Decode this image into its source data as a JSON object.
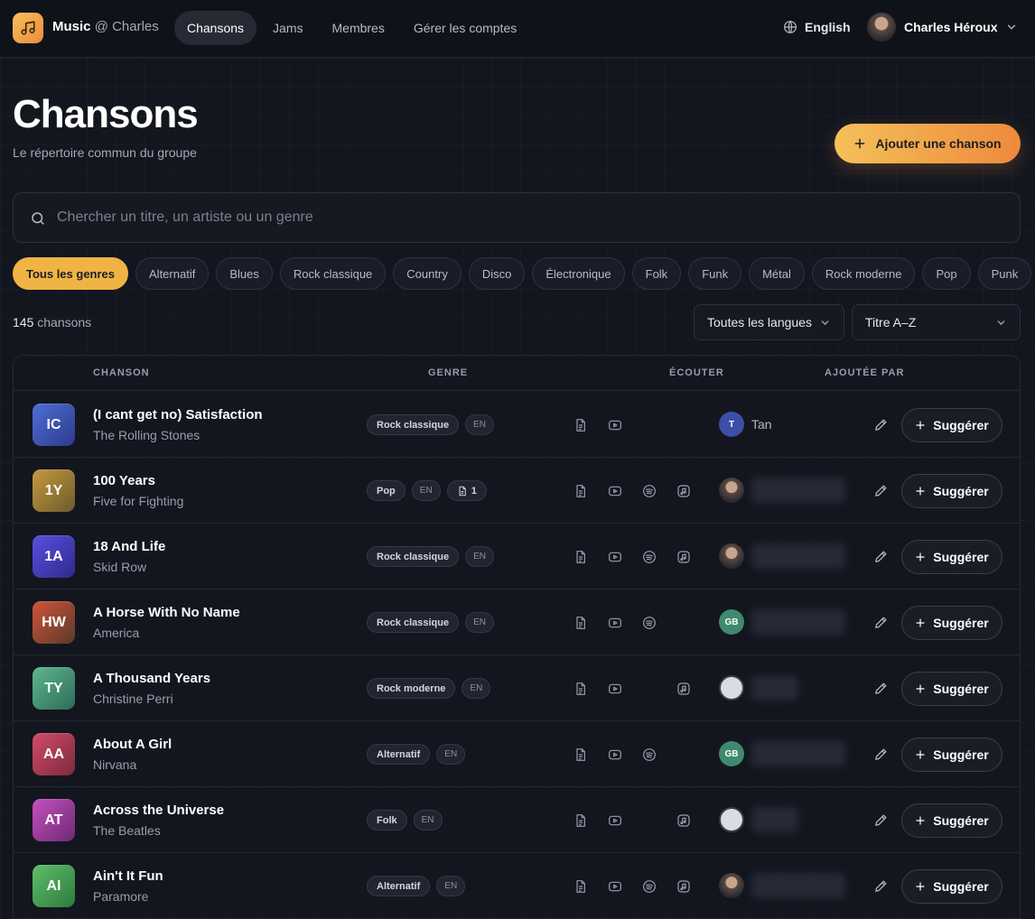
{
  "app": {
    "brand": "Music",
    "brand_suffix": "@ Charles"
  },
  "nav": [
    {
      "label": "Chansons",
      "active": true
    },
    {
      "label": "Jams",
      "active": false
    },
    {
      "label": "Membres",
      "active": false
    },
    {
      "label": "Gérer les comptes",
      "active": false
    }
  ],
  "language_switch": {
    "label": "English",
    "icon": "globe-icon"
  },
  "user": {
    "name": "Charles Héroux"
  },
  "page": {
    "title": "Chansons",
    "subtitle": "Le répertoire commun du groupe",
    "add_button": "Ajouter une chanson"
  },
  "search": {
    "placeholder": "Chercher un titre, un artiste ou un genre",
    "value": ""
  },
  "genres": [
    {
      "label": "Tous les genres",
      "active": true
    },
    {
      "label": "Alternatif"
    },
    {
      "label": "Blues"
    },
    {
      "label": "Rock classique"
    },
    {
      "label": "Country"
    },
    {
      "label": "Disco"
    },
    {
      "label": "Électronique"
    },
    {
      "label": "Folk"
    },
    {
      "label": "Funk"
    },
    {
      "label": "Métal"
    },
    {
      "label": "Rock moderne"
    },
    {
      "label": "Pop"
    },
    {
      "label": "Punk"
    }
  ],
  "count": {
    "number": "145",
    "label": "chansons"
  },
  "filters": {
    "language": "Toutes les langues",
    "sort": "Titre A–Z"
  },
  "table": {
    "headers": {
      "song": "CHANSON",
      "genre": "GENRE",
      "listen": "ÉCOUTER",
      "added_by": "AJOUTÉE PAR"
    },
    "suggest_label": "Suggérer",
    "rows": [
      {
        "initials": "IC",
        "title": "(I cant get no) Satisfaction",
        "artist": "The Rolling Stones",
        "genre": "Rock classique",
        "lang": "EN",
        "doc_count": null,
        "links": [
          "lyrics",
          "youtube"
        ],
        "adder": {
          "type": "initial",
          "initial": "T",
          "name": "Tan",
          "color": "#3c4fa6"
        },
        "colors": [
          "#4f6fd6",
          "#2c3a8c"
        ]
      },
      {
        "initials": "1Y",
        "title": "100 Years",
        "artist": "Five for Fighting",
        "genre": "Pop",
        "lang": "EN",
        "doc_count": "1",
        "links": [
          "lyrics",
          "youtube",
          "spotify",
          "apple"
        ],
        "adder": {
          "type": "photo"
        },
        "colors": [
          "#c79a3e",
          "#6b5a2c"
        ]
      },
      {
        "initials": "1A",
        "title": "18 And Life",
        "artist": "Skid Row",
        "genre": "Rock classique",
        "lang": "EN",
        "doc_count": null,
        "links": [
          "lyrics",
          "youtube",
          "spotify",
          "apple"
        ],
        "adder": {
          "type": "photo"
        },
        "colors": [
          "#5a4fe0",
          "#2d2a8e"
        ]
      },
      {
        "initials": "HW",
        "title": "A Horse With No Name",
        "artist": "America",
        "genre": "Rock classique",
        "lang": "EN",
        "doc_count": null,
        "links": [
          "lyrics",
          "youtube",
          "spotify"
        ],
        "adder": {
          "type": "initial",
          "initial": "GB",
          "color": "#3f8a6e"
        },
        "colors": [
          "#d0543a",
          "#5a3a2a"
        ]
      },
      {
        "initials": "TY",
        "title": "A Thousand Years",
        "artist": "Christine Perri",
        "genre": "Rock moderne",
        "lang": "EN",
        "doc_count": null,
        "links": [
          "lyrics",
          "youtube",
          "apple"
        ],
        "adder": {
          "type": "broken"
        },
        "colors": [
          "#5fb88d",
          "#2c6b58"
        ]
      },
      {
        "initials": "AA",
        "title": "About A Girl",
        "artist": "Nirvana",
        "genre": "Alternatif",
        "lang": "EN",
        "doc_count": null,
        "links": [
          "lyrics",
          "youtube",
          "spotify"
        ],
        "adder": {
          "type": "initial",
          "initial": "GB",
          "color": "#3f8a6e"
        },
        "colors": [
          "#d44b6a",
          "#7a2a3c"
        ]
      },
      {
        "initials": "AT",
        "title": "Across the Universe",
        "artist": "The Beatles",
        "genre": "Folk",
        "lang": "EN",
        "doc_count": null,
        "links": [
          "lyrics",
          "youtube",
          "apple"
        ],
        "adder": {
          "type": "broken"
        },
        "colors": [
          "#c84fc0",
          "#6c2a72"
        ]
      },
      {
        "initials": "AI",
        "title": "Ain't It Fun",
        "artist": "Paramore",
        "genre": "Alternatif",
        "lang": "EN",
        "doc_count": null,
        "links": [
          "lyrics",
          "youtube",
          "spotify",
          "apple"
        ],
        "adder": {
          "type": "photo"
        },
        "colors": [
          "#5fbf6a",
          "#2c7a3c"
        ]
      }
    ]
  }
}
